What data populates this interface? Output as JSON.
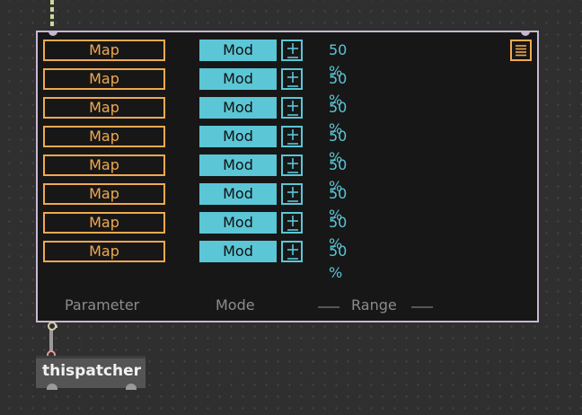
{
  "device": {
    "rows": [
      {
        "map_label": "Map",
        "mode_label": "Mod",
        "range": "50 %"
      },
      {
        "map_label": "Map",
        "mode_label": "Mod",
        "range": "50 %"
      },
      {
        "map_label": "Map",
        "mode_label": "Mod",
        "range": "50 %"
      },
      {
        "map_label": "Map",
        "mode_label": "Mod",
        "range": "50 %"
      },
      {
        "map_label": "Map",
        "mode_label": "Mod",
        "range": "50 %"
      },
      {
        "map_label": "Map",
        "mode_label": "Mod",
        "range": "50 %"
      },
      {
        "map_label": "Map",
        "mode_label": "Mod",
        "range": "50 %"
      },
      {
        "map_label": "Map",
        "mode_label": "Mod",
        "range": "50 %"
      }
    ],
    "footer": {
      "parameter": "Parameter",
      "mode": "Mode",
      "range": "Range"
    },
    "colors": {
      "map_orange": "#f0a94f",
      "mod_cyan": "#5bc6d6",
      "panel_bg": "#171717",
      "border": "#c7b8d0"
    }
  },
  "object": {
    "label": "thispatcher"
  },
  "icons": {
    "plus_minus": "plus-minus-icon",
    "menu": "menu-lines-icon"
  }
}
